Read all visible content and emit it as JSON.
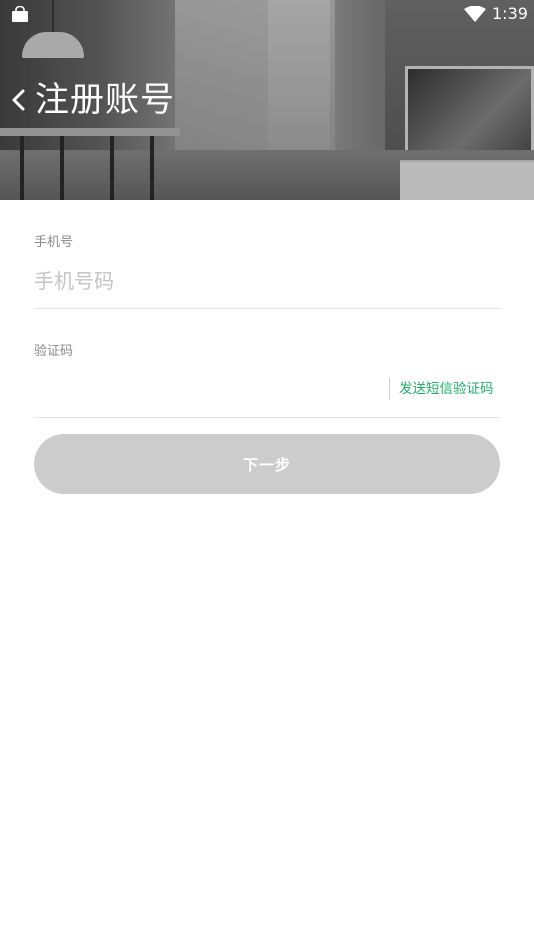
{
  "status_bar": {
    "time": "1:39",
    "left_icon": "shopping-bag-icon",
    "right_icon": "wifi-icon"
  },
  "header": {
    "back_icon": "chevron-left-icon",
    "title": "注册账号"
  },
  "form": {
    "phone": {
      "label": "手机号",
      "placeholder": "手机号码",
      "value": ""
    },
    "code": {
      "label": "验证码",
      "value": "",
      "send_label": "发送短信验证码"
    },
    "next_label": "下一步"
  },
  "colors": {
    "accent": "#1fb06a",
    "button_disabled": "#cccccc",
    "divider": "#e3e3e3"
  }
}
